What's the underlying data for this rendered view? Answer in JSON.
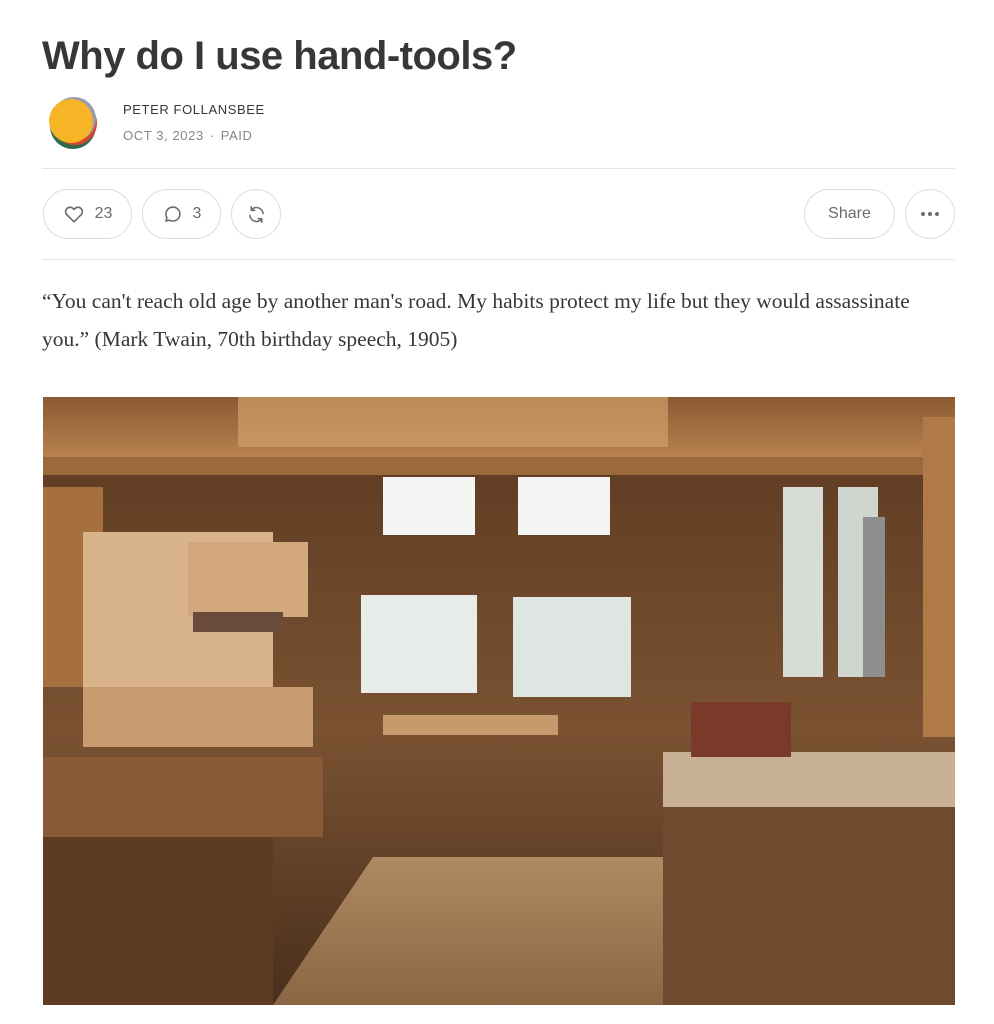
{
  "post": {
    "title": "Why do I use hand-tools?",
    "author": "PETER FOLLANSBEE",
    "date": "OCT 3, 2023",
    "access": "PAID"
  },
  "actions": {
    "like_icon": "heart-icon",
    "like_count": "23",
    "comment_icon": "comment-icon",
    "comment_count": "3",
    "restack_icon": "restack-icon",
    "share_label": "Share",
    "more_icon": "ellipsis-icon"
  },
  "body": {
    "quote": "“You can't reach old age by another man's road. My habits protect my life but they would assassinate you.” (Mark Twain, 70th birthday speech, 1905)"
  },
  "colors": {
    "text": "#363737",
    "muted": "#868787",
    "border": "#dcdcdc",
    "avatar_yellow": "#f6b427",
    "avatar_green": "#2f6b4a",
    "avatar_red": "#d9442b"
  }
}
